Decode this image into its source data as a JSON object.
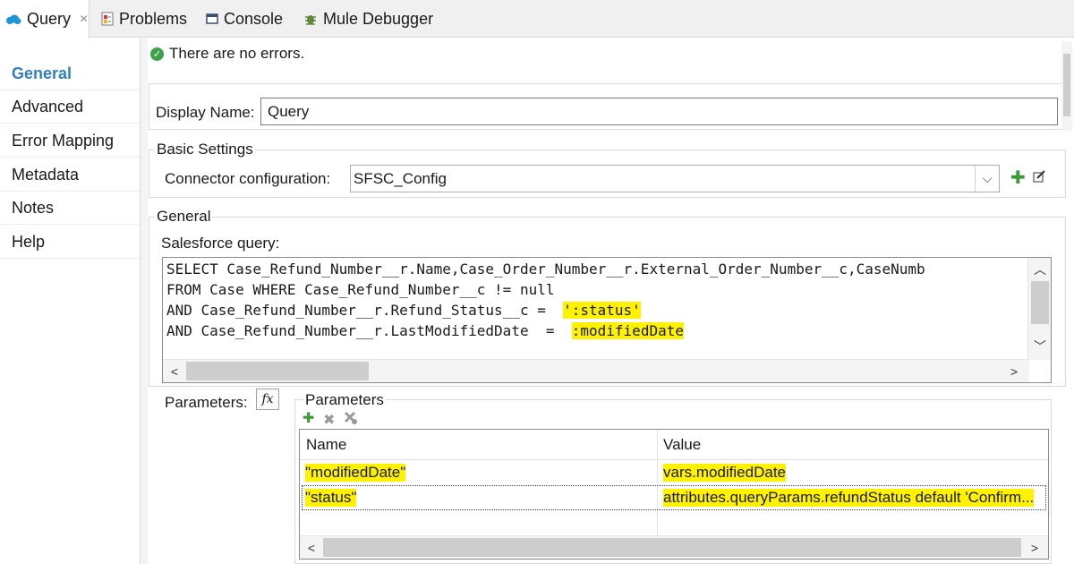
{
  "tabs": [
    {
      "label": "Query",
      "icon": "salesforce-cloud-icon",
      "active": true,
      "close": "×"
    },
    {
      "label": "Problems",
      "icon": "problems-icon"
    },
    {
      "label": "Console",
      "icon": "console-icon"
    },
    {
      "label": "Mule Debugger",
      "icon": "bug-icon"
    }
  ],
  "nav": {
    "items": [
      "General",
      "Advanced",
      "Error Mapping",
      "Metadata",
      "Notes",
      "Help"
    ],
    "active": "General",
    "active_color": "#2f7fc1"
  },
  "status": {
    "text": "There are no errors.",
    "icon": "check-circle-icon",
    "color": "#3ca24a"
  },
  "display_name": {
    "label": "Display Name:",
    "value": "Query"
  },
  "basic_settings": {
    "legend": "Basic Settings",
    "connector_label": "Connector configuration:",
    "connector_value": "SFSC_Config",
    "add_icon": "add-icon",
    "edit_icon": "edit-icon"
  },
  "general": {
    "legend": "General",
    "query_label": "Salesforce query:",
    "query_lines": [
      "SELECT Case_Refund_Number__r.Name,Case_Order_Number__r.External_Order_Number__c,CaseNumb",
      "FROM Case WHERE Case_Refund_Number__c != null",
      "AND Case_Refund_Number__r.Refund_Status__c =  ",
      "AND Case_Refund_Number__r.LastModifiedDate  =  "
    ],
    "query_highlights": [
      "':status'",
      ":modifiedDate"
    ],
    "highlight_color": "#fff200"
  },
  "parameters": {
    "label": "Parameters:",
    "fx_label": "fx",
    "legend": "Parameters",
    "toolbar_icons": [
      "add-icon",
      "delete-icon",
      "delete-all-icon"
    ],
    "columns": [
      "Name",
      "Value"
    ],
    "rows": [
      {
        "name": "\"modifiedDate\"",
        "value": "vars.modifiedDate"
      },
      {
        "name": "\"status\"",
        "value": "attributes.queryParams.refundStatus default 'Confirm..."
      }
    ]
  },
  "scroll": {
    "left": "<",
    "right": ">",
    "up": "^",
    "down": "v"
  }
}
